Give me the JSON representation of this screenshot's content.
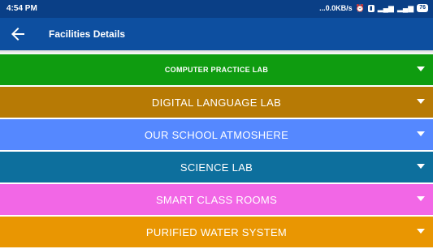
{
  "status_bar": {
    "time": "4:54 PM",
    "speed": "...0.0KB/s",
    "battery": "76"
  },
  "app_bar": {
    "title": "Facilities Details",
    "back_icon": "arrow-left-icon"
  },
  "colors": {
    "status_bar": "#0a3f86",
    "app_bar": "#0d4fa0"
  },
  "facilities": [
    {
      "label": "COMPUTER PRACTICE LAB",
      "color": "#0f9c10"
    },
    {
      "label": "DIGITAL LANGUAGE LAB",
      "color": "#b77a05"
    },
    {
      "label": "OUR SCHOOL ATMOSHERE",
      "color": "#5588ff"
    },
    {
      "label": "SCIENCE LAB",
      "color": "#0d6f9d"
    },
    {
      "label": "SMART CLASS ROOMS",
      "color": "#f267e6"
    },
    {
      "label": "PURIFIED WATER SYSTEM",
      "color": "#e99602"
    }
  ]
}
